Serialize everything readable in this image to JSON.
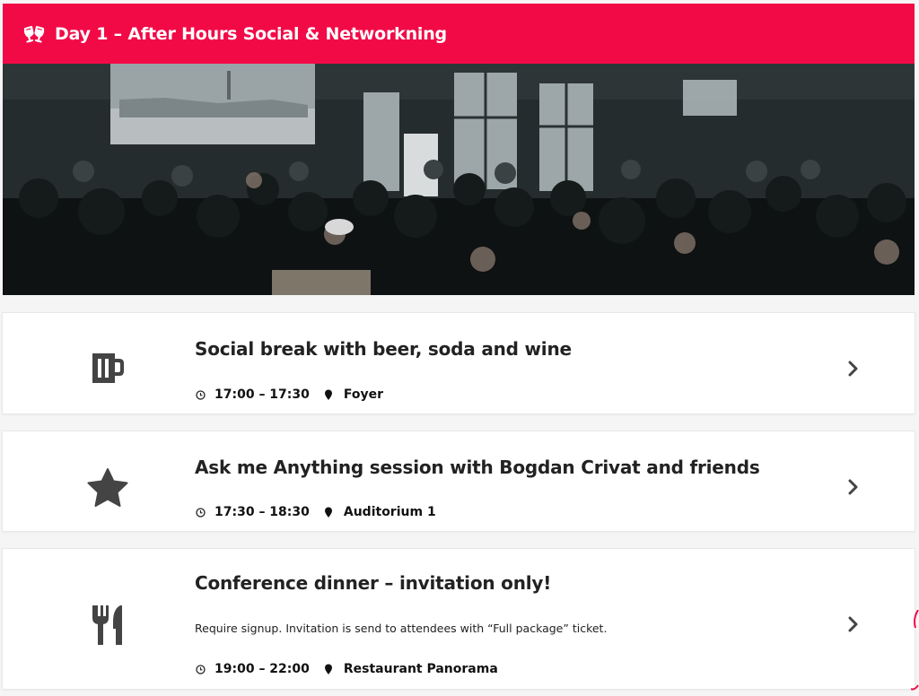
{
  "header": {
    "title": "Day 1 – After Hours Social & Networkning",
    "icon": "cheers-glasses-icon",
    "background": "#f20a47"
  },
  "photo": {
    "description_icon": "event-crowd-photo"
  },
  "sessions": [
    {
      "title": "Social break with beer, soda and wine",
      "time": "17:00 – 17:30",
      "location": "Foyer",
      "icon": "beer-mug-icon"
    },
    {
      "title": "Ask me Anything session with Bogdan Crivat and friends",
      "time": "17:30 – 18:30",
      "location": "Auditorium 1",
      "icon": "star-icon"
    },
    {
      "title": "Conference dinner – invitation only!",
      "description": "Require signup. Invitation is send to attendees with “Full package” ticket.",
      "time": "19:00 – 22:00",
      "location": "Restaurant Panorama",
      "icon": "fork-knife-icon"
    }
  ]
}
